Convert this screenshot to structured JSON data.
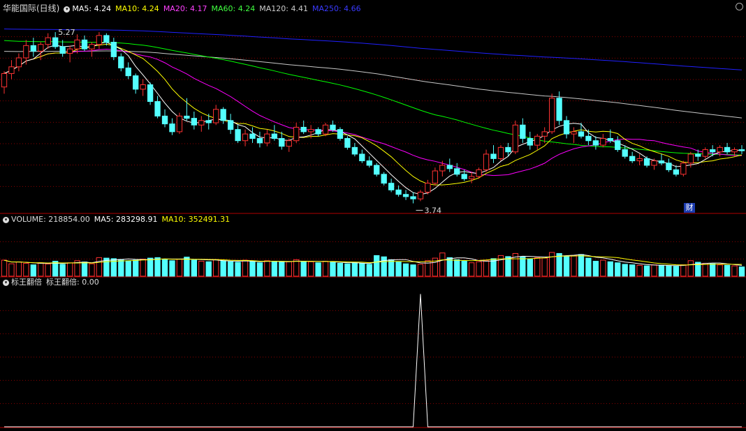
{
  "main_header": {
    "stock_name": "华能国际(日线)",
    "ma5": "MA5: 4.24",
    "ma10": "MA10: 4.24",
    "ma20": "MA20: 4.17",
    "ma60": "MA60: 4.24",
    "ma120": "MA120: 4.41",
    "ma250": "MA250: 4.66"
  },
  "volume_header": {
    "volume": "VOLUME: 218854.00",
    "ma5": "MA5: 283298.91",
    "ma10": "MA10: 352491.31"
  },
  "indicator_header": {
    "name": "标王翻倍",
    "value": "标王翻倍: 0.00"
  },
  "annotations": {
    "high_label": "5.27",
    "low_label": "3.74",
    "badge": "财"
  },
  "colors": {
    "up": "#ff3232",
    "down": "#54ffff",
    "ma5": "#ffffff",
    "ma10": "#ffff00",
    "ma20": "#ff00ff",
    "ma60": "#00ff00",
    "ma120": "#c8c8c8",
    "ma250": "#2020ff",
    "grid": "#8b0000"
  },
  "chart_data": {
    "type": "candlestick",
    "price_range": [
      3.7,
      5.42
    ],
    "ohlc": [
      [
        4.78,
        4.92,
        4.72,
        4.9
      ],
      [
        4.9,
        5.02,
        4.85,
        4.96
      ],
      [
        4.96,
        5.08,
        4.92,
        5.04
      ],
      [
        5.04,
        5.2,
        4.98,
        5.15
      ],
      [
        5.15,
        5.22,
        5.05,
        5.1
      ],
      [
        5.1,
        5.18,
        5.02,
        5.16
      ],
      [
        5.16,
        5.26,
        5.12,
        5.22
      ],
      [
        5.22,
        5.27,
        5.12,
        5.14
      ],
      [
        5.14,
        5.2,
        5.05,
        5.08
      ],
      [
        5.08,
        5.15,
        5.0,
        5.12
      ],
      [
        5.12,
        5.25,
        5.08,
        5.2
      ],
      [
        5.2,
        5.24,
        5.1,
        5.12
      ],
      [
        5.12,
        5.18,
        5.05,
        5.16
      ],
      [
        5.16,
        5.27,
        5.12,
        5.24
      ],
      [
        5.24,
        5.26,
        5.15,
        5.18
      ],
      [
        5.18,
        5.22,
        5.02,
        5.05
      ],
      [
        5.05,
        5.08,
        4.92,
        4.95
      ],
      [
        4.95,
        5.0,
        4.85,
        4.88
      ],
      [
        4.88,
        4.9,
        4.72,
        4.76
      ],
      [
        4.76,
        4.85,
        4.7,
        4.8
      ],
      [
        4.8,
        4.82,
        4.62,
        4.65
      ],
      [
        4.65,
        4.7,
        4.5,
        4.52
      ],
      [
        4.52,
        4.58,
        4.42,
        4.45
      ],
      [
        4.45,
        4.5,
        4.35,
        4.38
      ],
      [
        4.38,
        4.55,
        4.36,
        4.52
      ],
      [
        4.52,
        4.68,
        4.48,
        4.5
      ],
      [
        4.5,
        4.56,
        4.4,
        4.44
      ],
      [
        4.44,
        4.52,
        4.38,
        4.48
      ],
      [
        4.48,
        4.54,
        4.4,
        4.46
      ],
      [
        4.46,
        4.62,
        4.44,
        4.58
      ],
      [
        4.58,
        4.6,
        4.45,
        4.48
      ],
      [
        4.48,
        4.54,
        4.36,
        4.4
      ],
      [
        4.4,
        4.44,
        4.28,
        4.3
      ],
      [
        4.3,
        4.4,
        4.25,
        4.36
      ],
      [
        4.36,
        4.42,
        4.28,
        4.32
      ],
      [
        4.32,
        4.38,
        4.24,
        4.28
      ],
      [
        4.28,
        4.4,
        4.25,
        4.36
      ],
      [
        4.36,
        4.44,
        4.3,
        4.32
      ],
      [
        4.32,
        4.38,
        4.22,
        4.25
      ],
      [
        4.25,
        4.32,
        4.2,
        4.3
      ],
      [
        4.3,
        4.46,
        4.28,
        4.42
      ],
      [
        4.42,
        4.48,
        4.36,
        4.38
      ],
      [
        4.38,
        4.44,
        4.32,
        4.4
      ],
      [
        4.4,
        4.42,
        4.34,
        4.36
      ],
      [
        4.36,
        4.46,
        4.34,
        4.44
      ],
      [
        4.44,
        4.48,
        4.38,
        4.4
      ],
      [
        4.4,
        4.42,
        4.3,
        4.32
      ],
      [
        4.32,
        4.34,
        4.22,
        4.24
      ],
      [
        4.24,
        4.28,
        4.16,
        4.18
      ],
      [
        4.18,
        4.22,
        4.1,
        4.12
      ],
      [
        4.12,
        4.16,
        4.06,
        4.08
      ],
      [
        4.08,
        4.1,
        3.98,
        4.0
      ],
      [
        4.0,
        4.02,
        3.9,
        3.92
      ],
      [
        3.92,
        3.96,
        3.84,
        3.86
      ],
      [
        3.86,
        3.9,
        3.8,
        3.82
      ],
      [
        3.82,
        3.86,
        3.77,
        3.8
      ],
      [
        3.8,
        3.84,
        3.74,
        3.78
      ],
      [
        3.78,
        3.86,
        3.76,
        3.84
      ],
      [
        3.84,
        3.95,
        3.82,
        3.92
      ],
      [
        3.92,
        4.06,
        3.9,
        4.03
      ],
      [
        4.03,
        4.12,
        3.98,
        4.08
      ],
      [
        4.08,
        4.14,
        4.02,
        4.05
      ],
      [
        4.05,
        4.1,
        3.98,
        4.0
      ],
      [
        4.0,
        4.04,
        3.94,
        3.96
      ],
      [
        3.96,
        4.02,
        3.92,
        3.98
      ],
      [
        3.98,
        4.06,
        3.96,
        4.04
      ],
      [
        4.04,
        4.22,
        4.02,
        4.18
      ],
      [
        4.18,
        4.26,
        4.1,
        4.14
      ],
      [
        4.14,
        4.26,
        4.12,
        4.24
      ],
      [
        4.24,
        4.28,
        4.16,
        4.2
      ],
      [
        4.2,
        4.48,
        4.18,
        4.44
      ],
      [
        4.44,
        4.5,
        4.28,
        4.32
      ],
      [
        4.32,
        4.38,
        4.22,
        4.26
      ],
      [
        4.26,
        4.36,
        4.22,
        4.34
      ],
      [
        4.34,
        4.42,
        4.28,
        4.38
      ],
      [
        4.38,
        4.72,
        4.36,
        4.68
      ],
      [
        4.68,
        4.74,
        4.44,
        4.48
      ],
      [
        4.48,
        4.52,
        4.32,
        4.36
      ],
      [
        4.36,
        4.42,
        4.28,
        4.38
      ],
      [
        4.38,
        4.46,
        4.32,
        4.34
      ],
      [
        4.34,
        4.4,
        4.26,
        4.3
      ],
      [
        4.3,
        4.34,
        4.22,
        4.26
      ],
      [
        4.26,
        4.36,
        4.24,
        4.32
      ],
      [
        4.32,
        4.4,
        4.28,
        4.3
      ],
      [
        4.3,
        4.34,
        4.2,
        4.22
      ],
      [
        4.22,
        4.26,
        4.14,
        4.16
      ],
      [
        4.16,
        4.2,
        4.1,
        4.12
      ],
      [
        4.12,
        4.18,
        4.08,
        4.14
      ],
      [
        4.14,
        4.16,
        4.06,
        4.08
      ],
      [
        4.08,
        4.14,
        4.04,
        4.12
      ],
      [
        4.12,
        4.18,
        4.08,
        4.1
      ],
      [
        4.1,
        4.14,
        4.02,
        4.04
      ],
      [
        4.04,
        4.08,
        3.98,
        4.0
      ],
      [
        4.0,
        4.12,
        3.98,
        4.1
      ],
      [
        4.1,
        4.2,
        4.06,
        4.18
      ],
      [
        4.18,
        4.22,
        4.12,
        4.16
      ],
      [
        4.16,
        4.24,
        4.14,
        4.22
      ],
      [
        4.22,
        4.26,
        4.16,
        4.2
      ],
      [
        4.2,
        4.26,
        4.16,
        4.24
      ],
      [
        4.24,
        4.28,
        4.18,
        4.2
      ],
      [
        4.2,
        4.24,
        4.16,
        4.22
      ],
      [
        4.22,
        4.26,
        4.18,
        4.21
      ]
    ],
    "volume": [
      62,
      48,
      55,
      50,
      44,
      52,
      47,
      58,
      46,
      52,
      60,
      55,
      48,
      72,
      70,
      68,
      65,
      60,
      62,
      66,
      70,
      72,
      64,
      60,
      66,
      74,
      62,
      58,
      56,
      64,
      60,
      56,
      54,
      62,
      58,
      52,
      60,
      58,
      54,
      56,
      64,
      58,
      56,
      52,
      58,
      54,
      50,
      48,
      52,
      50,
      46,
      80,
      75,
      64,
      55,
      48,
      44,
      46,
      60,
      70,
      90,
      72,
      64,
      58,
      52,
      56,
      60,
      68,
      80,
      76,
      88,
      74,
      66,
      72,
      70,
      92,
      88,
      76,
      80,
      84,
      70,
      58,
      62,
      56,
      52,
      46,
      44,
      42,
      40,
      44,
      42,
      40,
      38,
      44,
      60,
      54,
      50,
      48,
      44,
      42,
      40,
      36
    ],
    "volume_range": [
      0,
      200
    ],
    "indicator": {
      "name": "标王翻倍",
      "spike_index": 57,
      "spike_value": 1,
      "range": [
        0,
        1.05
      ]
    }
  }
}
